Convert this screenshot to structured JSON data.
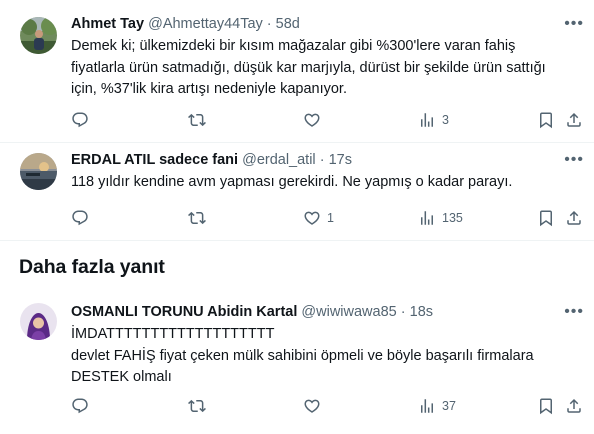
{
  "tweets": [
    {
      "name": "Ahmet Tay",
      "handle": "@Ahmettay44Tay",
      "dot": "·",
      "time": "58d",
      "lines": [
        "Demek ki; ülkemizdeki bir kısım mağazalar gibi %300'lere varan fahiş",
        "fiyatlarla ürün satmadığı, düşük kar marjıyla, dürüst bir şekilde ürün sattığı",
        "için, %37'lik kira artışı nedeniyle kapanıyor."
      ],
      "replies": "",
      "retweets": "",
      "likes": "",
      "views": "3"
    },
    {
      "name": "ERDAL ATIL sadece fani",
      "handle": "@erdal_atil",
      "dot": "·",
      "time": "17s",
      "lines": [
        "118 yıldır kendine avm yapması gerekirdi. Ne yapmış o kadar parayı."
      ],
      "replies": "",
      "retweets": "",
      "likes": "1",
      "views": "135"
    },
    {
      "name": "OSMANLI TORUNU Abidin Kartal",
      "handle": "@wiwiwawa85",
      "dot": "·",
      "time": "18s",
      "lines": [
        "İMDATTTTTTTTTTTTTTTTTTT",
        "devlet FAHİŞ fiyat çeken mülk sahibini öpmeli ve böyle başarılı firmalara",
        "DESTEK olmalı"
      ],
      "replies": "",
      "retweets": "",
      "likes": "",
      "views": "37"
    }
  ],
  "section": {
    "title": "Daha fazla yanıt"
  },
  "icons": {
    "more": "more-horizontal-icon",
    "reply": "reply-icon",
    "retweet": "retweet-icon",
    "like": "heart-icon",
    "views": "views-chart-icon",
    "bookmark": "bookmark-icon",
    "share": "share-icon"
  },
  "colors": {
    "text": "#0f1419",
    "secondary": "#536471",
    "divider": "#eff3f4"
  }
}
